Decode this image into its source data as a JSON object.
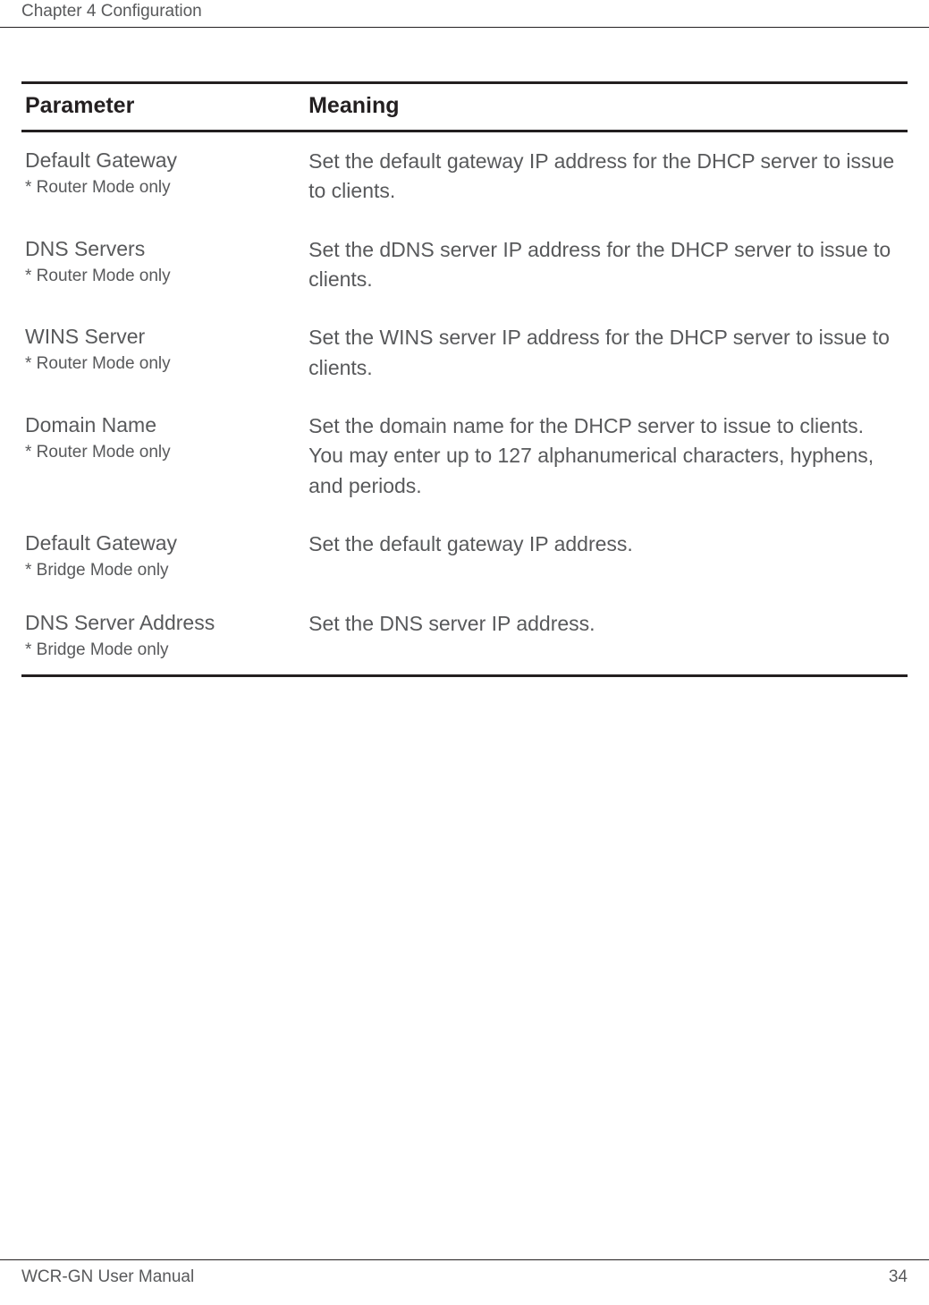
{
  "header": {
    "chapter": "Chapter 4  Configuration"
  },
  "table": {
    "headers": {
      "parameter": "Parameter",
      "meaning": "Meaning"
    },
    "rows": [
      {
        "name": "Default Gateway",
        "note": "* Router Mode only",
        "meaning": "Set the default gateway IP address for the DHCP server to issue to clients."
      },
      {
        "name": "DNS Servers",
        "note": "* Router Mode only",
        "meaning": "Set the dDNS server IP address for the DHCP server to issue to clients."
      },
      {
        "name": "WINS Server",
        "note": "* Router Mode only",
        "meaning": "Set the WINS server IP address for the DHCP server to issue to clients."
      },
      {
        "name": "Domain Name",
        "note": "* Router Mode only",
        "meaning": "Set the domain name for the DHCP server to issue to clients. You may enter up to 127 alphanumerical characters, hyphens, and periods."
      },
      {
        "name": "Default Gateway",
        "note": "* Bridge Mode only",
        "meaning": "Set the default gateway IP address."
      },
      {
        "name": "DNS Server Address",
        "note": "* Bridge Mode only",
        "meaning": "Set the DNS server IP address."
      }
    ]
  },
  "footer": {
    "manual": "WCR-GN User Manual",
    "page": "34"
  }
}
